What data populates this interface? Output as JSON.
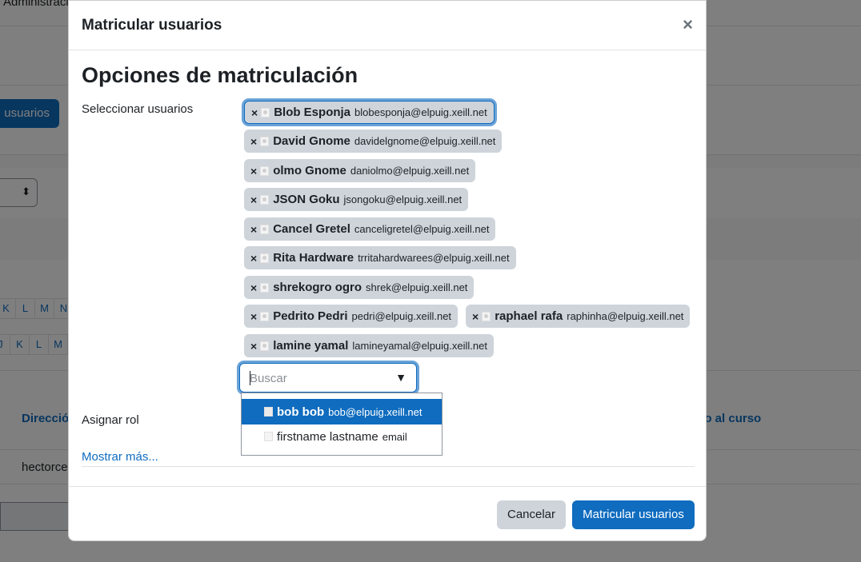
{
  "background": {
    "topbar_text": "Administració",
    "enrol_button": "usuarios",
    "letters_row1": [
      "K",
      "L",
      "M",
      "N"
    ],
    "letters_row2": [
      "J",
      "K",
      "L",
      "M"
    ],
    "col_direccion": "Direcció",
    "col_acceso": "so al curso",
    "cell_user": "hectorce"
  },
  "modal": {
    "title": "Matricular usuarios",
    "close_label": "×",
    "section_title": "Opciones de matriculación",
    "select_users_label": "Seleccionar usuarios",
    "assign_role_label": "Asignar rol",
    "show_more_label": "Mostrar más...",
    "remove_symbol": "×",
    "selected_users": [
      {
        "name": "Blob Esponja",
        "email": "blobesponja@elpuig.xeill.net"
      },
      {
        "name": "David Gnome",
        "email": "davidelgnome@elpuig.xeill.net"
      },
      {
        "name": "olmo Gnome",
        "email": "daniolmo@elpuig.xeill.net"
      },
      {
        "name": "JSON Goku",
        "email": "jsongoku@elpuig.xeill.net"
      },
      {
        "name": "Cancel Gretel",
        "email": "canceligretel@elpuig.xeill.net"
      },
      {
        "name": "Rita Hardware",
        "email": "trritahardwarees@elpuig.xeill.net"
      },
      {
        "name": "shrekogro ogro",
        "email": "shrek@elpuig.xeill.net"
      },
      {
        "name": "Pedrito Pedri",
        "email": "pedri@elpuig.xeill.net"
      },
      {
        "name": "raphael rafa",
        "email": "raphinha@elpuig.xeill.net"
      },
      {
        "name": "lamine yamal",
        "email": "lamineyamal@elpuig.xeill.net"
      }
    ],
    "search": {
      "placeholder": "Buscar",
      "value": "",
      "arrow": "▼"
    },
    "suggestions": [
      {
        "name": "bob bob",
        "email": "bob@elpuig.xeill.net",
        "selected": true
      },
      {
        "name": "firstname lastname",
        "email": "email",
        "selected": false
      }
    ],
    "cancel_label": "Cancelar",
    "submit_label": "Matricular usuarios"
  },
  "colors": {
    "primary": "#0f6cbf",
    "chip_bg": "#ced4da",
    "focus_ring": "#6aa3d8"
  }
}
